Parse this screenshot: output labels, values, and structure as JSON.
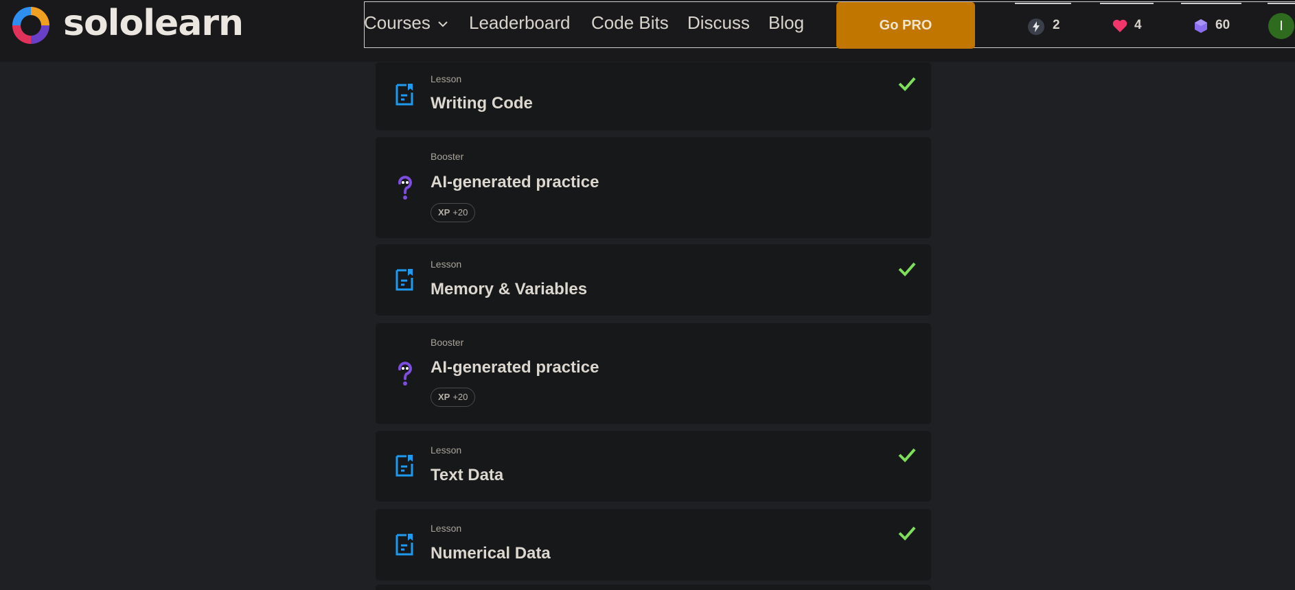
{
  "header": {
    "brand": "sololearn",
    "nav": [
      {
        "label": "Courses"
      },
      {
        "label": "Leaderboard"
      },
      {
        "label": "Code Bits"
      },
      {
        "label": "Discuss"
      },
      {
        "label": "Blog"
      }
    ],
    "go_pro": "Go PRO",
    "stats": {
      "streak": "2",
      "hearts": "4",
      "gems": "60"
    },
    "avatar_initial": "I"
  },
  "lessons": [
    {
      "type": "Lesson",
      "title": "Writing Code",
      "completed": true
    },
    {
      "type": "Booster",
      "title": "AI-generated practice",
      "xp_label": "XP",
      "xp_value": "+20"
    },
    {
      "type": "Lesson",
      "title": "Memory & Variables",
      "completed": true
    },
    {
      "type": "Booster",
      "title": "AI-generated practice",
      "xp_label": "XP",
      "xp_value": "+20"
    },
    {
      "type": "Lesson",
      "title": "Text Data",
      "completed": true
    },
    {
      "type": "Lesson",
      "title": "Numerical Data",
      "completed": true
    }
  ],
  "colors": {
    "accent": "#c17600",
    "lesson_icon": "#1e9bf0",
    "booster_icon": "#7d4de0",
    "check": "#7ee05a"
  }
}
